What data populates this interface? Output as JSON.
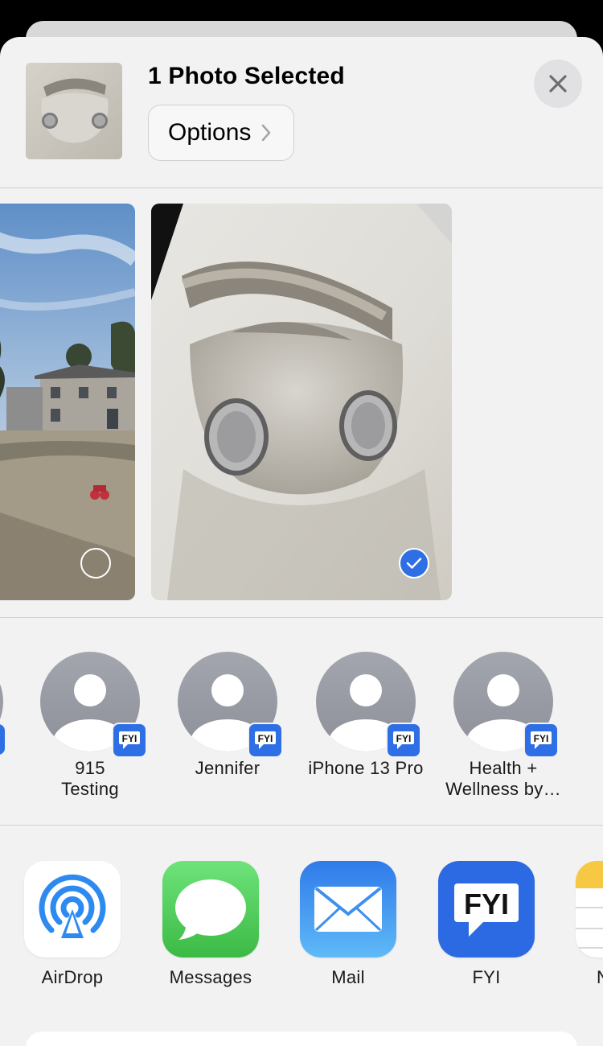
{
  "header": {
    "title": "1 Photo Selected",
    "options_label": "Options",
    "close_icon": "close-icon"
  },
  "photos": [
    {
      "name": "house-photo",
      "selected": false
    },
    {
      "name": "mask-photo",
      "selected": true
    }
  ],
  "people": [
    {
      "label_line1": "915",
      "label_line2": "Testing",
      "badge": "FYI"
    },
    {
      "label_line1": "Jennifer",
      "label_line2": "",
      "badge": "FYI"
    },
    {
      "label_line1": "iPhone 13 Pro",
      "label_line2": "",
      "badge": "FYI"
    },
    {
      "label_line1": "Health +",
      "label_line2": "Wellness by…",
      "badge": "FYI"
    }
  ],
  "apps": [
    {
      "label": "AirDrop",
      "icon": "airdrop-icon"
    },
    {
      "label": "Messages",
      "icon": "messages-icon"
    },
    {
      "label": "Mail",
      "icon": "mail-icon"
    },
    {
      "label": "FYI",
      "icon": "fyi-icon",
      "text": "FYI"
    },
    {
      "label": "N",
      "icon": "notes-icon"
    }
  ],
  "colors": {
    "accent": "#2f6fe6",
    "sheet": "#f2f2f2"
  }
}
